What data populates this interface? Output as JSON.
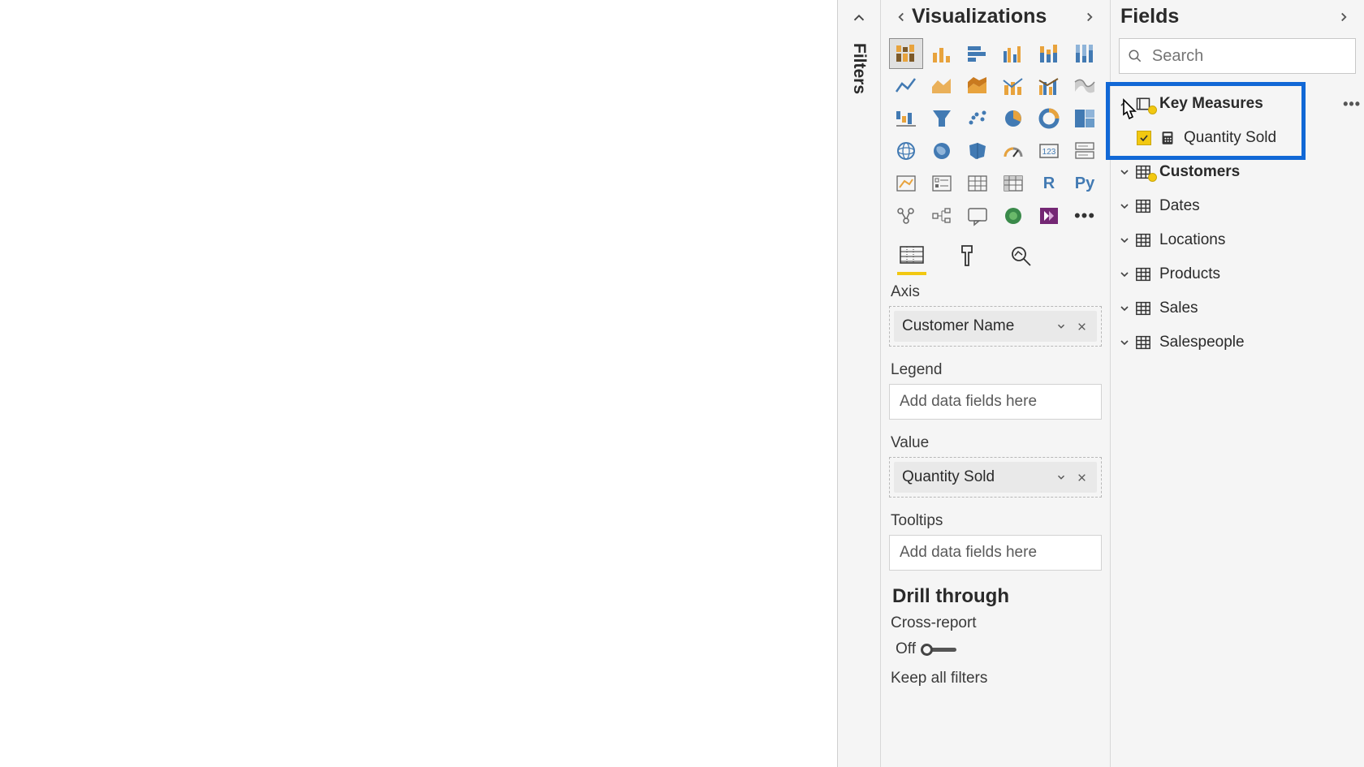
{
  "panels": {
    "filters_label": "Filters",
    "visualizations_title": "Visualizations",
    "fields_title": "Fields"
  },
  "visual_icons": [
    {
      "name": "stacked-bar-chart-icon",
      "selected": true
    },
    {
      "name": "column-chart-icon"
    },
    {
      "name": "bar-chart-icon"
    },
    {
      "name": "clustered-column-chart-icon"
    },
    {
      "name": "stacked-column-chart-icon"
    },
    {
      "name": "100-stacked-column-chart-icon"
    },
    {
      "name": "line-chart-icon"
    },
    {
      "name": "area-chart-icon"
    },
    {
      "name": "stacked-area-chart-icon"
    },
    {
      "name": "line-stacked-column-chart-icon"
    },
    {
      "name": "line-clustered-column-chart-icon"
    },
    {
      "name": "ribbon-chart-icon"
    },
    {
      "name": "waterfall-chart-icon"
    },
    {
      "name": "funnel-chart-icon"
    },
    {
      "name": "scatter-chart-icon"
    },
    {
      "name": "pie-chart-icon"
    },
    {
      "name": "donut-chart-icon"
    },
    {
      "name": "treemap-icon"
    },
    {
      "name": "map-globe-icon"
    },
    {
      "name": "filled-map-icon"
    },
    {
      "name": "shape-map-icon"
    },
    {
      "name": "gauge-icon"
    },
    {
      "name": "card-icon"
    },
    {
      "name": "multirow-card-icon"
    },
    {
      "name": "kpi-icon"
    },
    {
      "name": "slicer-icon"
    },
    {
      "name": "table-visual-icon"
    },
    {
      "name": "matrix-icon"
    },
    {
      "name": "r-visual-icon"
    },
    {
      "name": "python-visual-icon"
    },
    {
      "name": "key-influencers-icon"
    },
    {
      "name": "decomposition-tree-icon"
    },
    {
      "name": "qna-visual-icon"
    },
    {
      "name": "arcgis-map-icon"
    },
    {
      "name": "powerapps-visual-icon"
    },
    {
      "name": "more-visuals-icon"
    }
  ],
  "well_sections": {
    "axis": {
      "label": "Axis",
      "field": "Customer Name"
    },
    "legend": {
      "label": "Legend",
      "placeholder": "Add data fields here"
    },
    "value": {
      "label": "Value",
      "field": "Quantity Sold"
    },
    "tooltips": {
      "label": "Tooltips",
      "placeholder": "Add data fields here"
    }
  },
  "drill_through": {
    "heading": "Drill through",
    "cross_report_label": "Cross-report",
    "cross_report_state": "Off",
    "keep_all_filters_label": "Keep all filters"
  },
  "search": {
    "placeholder": "Search"
  },
  "tables": [
    {
      "name": "Key Measures",
      "expanded": true,
      "highlighted": true,
      "special": true,
      "fields": [
        {
          "name": "Quantity Sold",
          "checked": true,
          "type": "calc"
        }
      ]
    },
    {
      "name": "Customers",
      "expanded": false,
      "badge": true
    },
    {
      "name": "Dates",
      "expanded": false
    },
    {
      "name": "Locations",
      "expanded": false
    },
    {
      "name": "Products",
      "expanded": false
    },
    {
      "name": "Sales",
      "expanded": false
    },
    {
      "name": "Salespeople",
      "expanded": false
    }
  ]
}
